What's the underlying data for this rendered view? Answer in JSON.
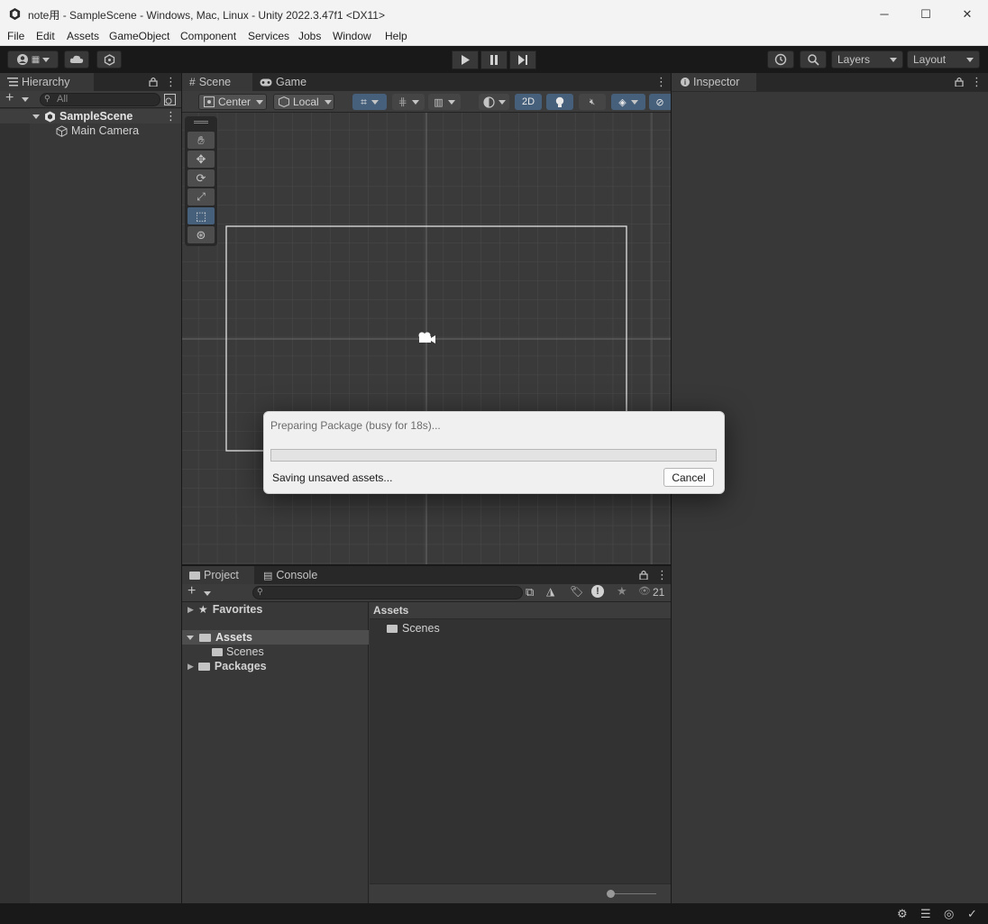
{
  "window": {
    "title": "note用 - SampleScene - Windows, Mac, Linux - Unity 2022.3.47f1 <DX11>",
    "minimize_label": "─",
    "maximize_label": "☐",
    "close_label": "✕"
  },
  "menu": [
    "File",
    "Edit",
    "Assets",
    "GameObject",
    "Component",
    "Services",
    "Jobs",
    "Window",
    "Help"
  ],
  "toolbar": {
    "layers_label": "Layers",
    "layout_label": "Layout",
    "account_icon": "account-icon",
    "cloud_icon": "cloud-icon",
    "collab_icon": "collab-icon"
  },
  "hierarchy": {
    "tab_label": "Hierarchy",
    "search_placeholder": "All",
    "scene_name": "SampleScene",
    "items": [
      "Main Camera"
    ]
  },
  "scene": {
    "tabs": [
      "Scene",
      "Game"
    ],
    "pivot_label": "Center",
    "space_label": "Local",
    "mode_2d_label": "2D",
    "tools": [
      "hand-tool",
      "move-tool",
      "rotate-tool",
      "scale-tool",
      "rect-tool",
      "transform-tool"
    ],
    "active_tool": "rect-tool"
  },
  "inspector": {
    "tab_label": "Inspector"
  },
  "project": {
    "tabs": [
      "Project",
      "Console"
    ],
    "favorites_label": "Favorites",
    "assets_label": "Assets",
    "scenes_label": "Scenes",
    "packages_label": "Packages",
    "breadcrumb": "Assets",
    "folder_items": [
      "Scenes"
    ],
    "hidden_count": "21"
  },
  "dialog": {
    "title": "Preparing Package (busy for 18s)...",
    "status": "Saving unsaved assets...",
    "cancel_label": "Cancel",
    "progress": 0.0
  },
  "colors": {
    "panel_bg": "#383838",
    "dark_bg": "#191919",
    "accent_blue": "#46607c",
    "selection": "#4d4d4d"
  }
}
